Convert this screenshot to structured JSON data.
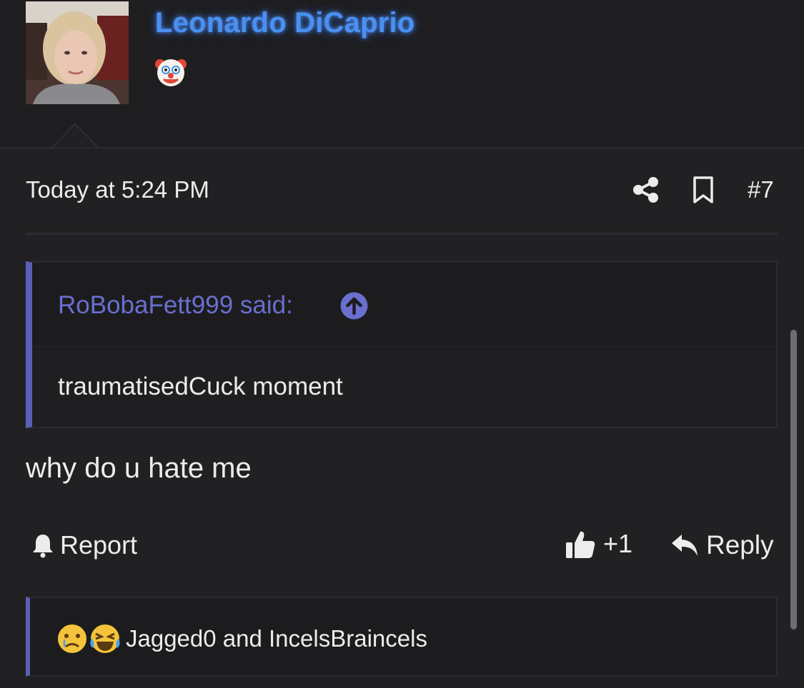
{
  "user": {
    "name": "Leonardo DiCaprio",
    "flair_icon": "clown-face-emoji",
    "name_color": "#4a90f0"
  },
  "post": {
    "timestamp": "Today at 5:24 PM",
    "number": "#7",
    "share_icon": "share-icon",
    "bookmark_icon": "bookmark-icon"
  },
  "quote": {
    "author_label": "RoBobaFett999 said:",
    "body": "traumatisedCuck moment",
    "accent_color": "#5b5fb5"
  },
  "message": "why do u hate me",
  "actions": {
    "report_label": "Report",
    "like_label": "+1",
    "reply_label": "Reply"
  },
  "reactions": {
    "icons": [
      "crying-face-emoji",
      "laughing-tears-face-emoji"
    ],
    "text": "Jagged0 and IncelsBraincels"
  }
}
